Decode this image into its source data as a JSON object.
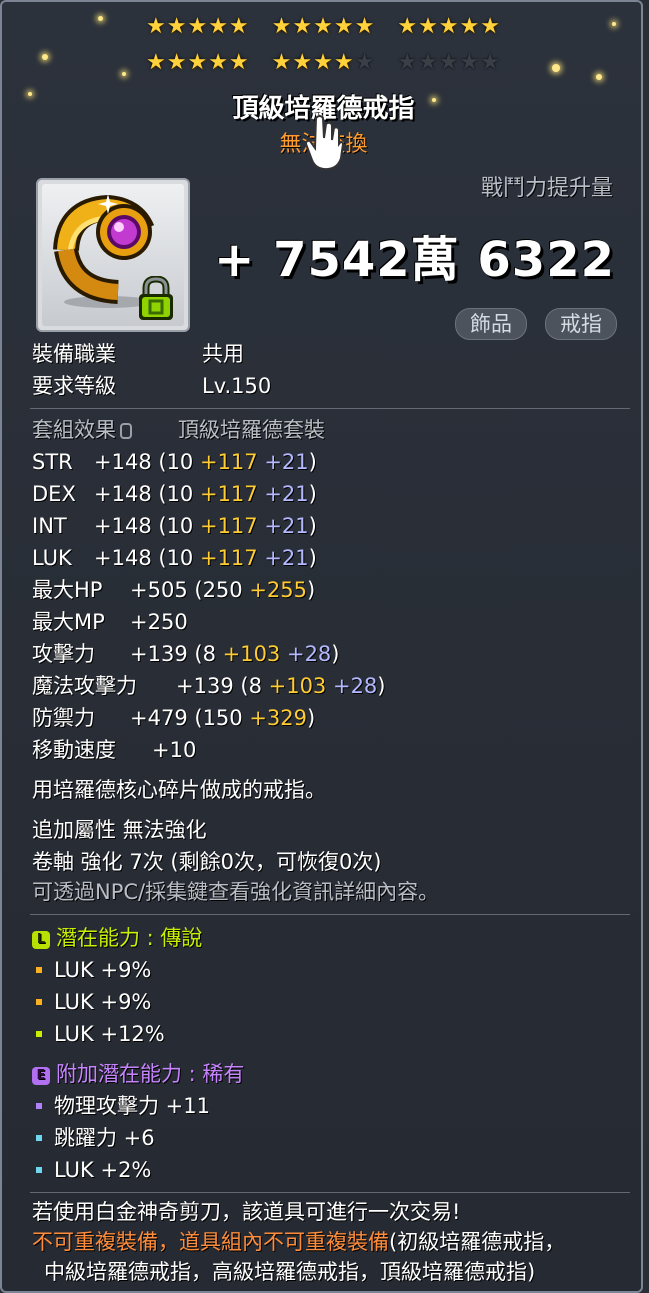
{
  "stars": {
    "row1_filled": 15,
    "row1_total": 15,
    "row2_filled": 9,
    "row2_total": 15
  },
  "item": {
    "name": "頂級培羅德戒指",
    "trade_status": "無法交換",
    "power_label": "戰鬥力提升量",
    "power_value": "+ 7542萬 6322",
    "tags": [
      "飾品",
      "戒指"
    ],
    "icon": "ring-gem-icon",
    "lock_icon": "lock-icon"
  },
  "requirements": [
    {
      "label": "裝備職業",
      "value": "共用"
    },
    {
      "label": "要求等級",
      "value": "Lv.150"
    }
  ],
  "set": {
    "label": "套組效果",
    "value": "頂級培羅德套裝"
  },
  "stats": [
    {
      "name": "STR",
      "total": "+148",
      "open": "(10 ",
      "a": "+117",
      "b": " +21",
      "close": ")"
    },
    {
      "name": "DEX",
      "total": "+148",
      "open": "(10 ",
      "a": "+117",
      "b": " +21",
      "close": ")"
    },
    {
      "name": "INT",
      "total": "+148",
      "open": "(10 ",
      "a": "+117",
      "b": " +21",
      "close": ")"
    },
    {
      "name": "LUK",
      "total": "+148",
      "open": "(10 ",
      "a": "+117",
      "b": " +21",
      "close": ")"
    },
    {
      "name": "最大HP",
      "total": "+505",
      "open": "(250 ",
      "a": "+255",
      "b": "",
      "close": ")"
    },
    {
      "name": "最大MP",
      "total": "+250",
      "open": "",
      "a": "",
      "b": "",
      "close": ""
    },
    {
      "name": "攻擊力",
      "total": "+139",
      "open": "(8 ",
      "a": "+103",
      "b": " +28",
      "close": ")"
    },
    {
      "name": "魔法攻擊力",
      "total": "+139",
      "open": "(8 ",
      "a": "+103",
      "b": " +28",
      "close": ")"
    },
    {
      "name": "防禦力",
      "total": "+479",
      "open": "(150 ",
      "a": "+329",
      "b": "",
      "close": ")"
    },
    {
      "name": "移動速度",
      "total": "+10",
      "open": "",
      "a": "",
      "b": "",
      "close": ""
    }
  ],
  "description": "用培羅德核心碎片做成的戒指。",
  "enhance": {
    "line1": "追加屬性 無法強化",
    "line2": "卷軸 強化 7次 (剩餘0次，可恢復0次)",
    "line3": "可透過NPC/採集鍵查看強化資訊詳細內容。"
  },
  "potential": {
    "badge": "L",
    "label": "潛在能力 : 傳說",
    "color": "#c8f000",
    "lines": [
      {
        "text": "LUK +9%",
        "dot": "#ffb020"
      },
      {
        "text": "LUK +9%",
        "dot": "#ffb020"
      },
      {
        "text": "LUK +12%",
        "dot": "#c8f000"
      }
    ]
  },
  "additional": {
    "badge": "E",
    "label": "附加潛在能力 : 稀有",
    "color": "#c784ff",
    "lines": [
      {
        "text": "物理攻擊力 +11",
        "dot": "#b080ff"
      },
      {
        "text": "跳躍力 +6",
        "dot": "#6fd8f0"
      },
      {
        "text": "LUK +2%",
        "dot": "#6fd8f0"
      }
    ]
  },
  "footer": {
    "line1": "若使用白金神奇剪刀，該道具可進行一次交易!",
    "line2_warn": "不可重複裝備，道具組內不可重複裝備",
    "line2_rest": "(初級培羅德戒指，",
    "line3": "中級培羅德戒指，高級培羅德戒指，頂級培羅德戒指)"
  }
}
